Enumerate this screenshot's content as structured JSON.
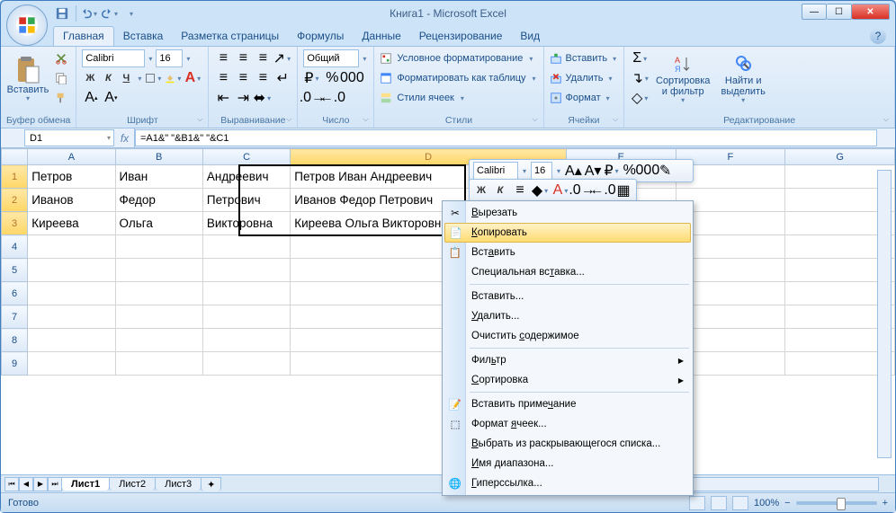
{
  "window": {
    "title": "Книга1 - Microsoft Excel"
  },
  "qat": {
    "save": "save-icon",
    "undo": "undo-icon",
    "redo": "redo-icon"
  },
  "tabs": {
    "items": [
      "Главная",
      "Вставка",
      "Разметка страницы",
      "Формулы",
      "Данные",
      "Рецензирование",
      "Вид"
    ],
    "active": 0
  },
  "ribbon": {
    "clipboard": {
      "paste": "Вставить",
      "label": "Буфер обмена"
    },
    "font": {
      "name": "Calibri",
      "size": "16",
      "label": "Шрифт",
      "bold": "Ж",
      "italic": "К",
      "underline": "Ч"
    },
    "alignment": {
      "label": "Выравнивание"
    },
    "number": {
      "format": "Общий",
      "label": "Число"
    },
    "styles": {
      "cond": "Условное форматирование",
      "table": "Форматировать как таблицу",
      "cell": "Стили ячеек",
      "label": "Стили"
    },
    "cells": {
      "insert": "Вставить",
      "delete": "Удалить",
      "format": "Формат",
      "label": "Ячейки"
    },
    "editing": {
      "sort": "Сортировка и фильтр",
      "find": "Найти и выделить",
      "label": "Редактирование"
    }
  },
  "namebox": "D1",
  "formula": "=A1&\" \"&B1&\" \"&C1",
  "columns": [
    "A",
    "B",
    "C",
    "D",
    "E",
    "F",
    "G"
  ],
  "rows": [
    "1",
    "2",
    "3",
    "4",
    "5",
    "6",
    "7",
    "8",
    "9"
  ],
  "cells": {
    "r1": {
      "a": "Петров",
      "b": "Иван",
      "c": "Андреевич",
      "d": "Петров Иван Андреевич"
    },
    "r2": {
      "a": "Иванов",
      "b": "Федор",
      "c": "Петрович",
      "d": "Иванов Федор Петрович"
    },
    "r3": {
      "a": "Киреева",
      "b": "Ольга",
      "c": "Викторовна",
      "d": "Киреева Ольга Викторовна"
    }
  },
  "sheets": {
    "items": [
      "Лист1",
      "Лист2",
      "Лист3"
    ],
    "active": 0
  },
  "status": {
    "ready": "Готово",
    "zoom": "100%"
  },
  "mini": {
    "font": "Calibri",
    "size": "16",
    "bold": "Ж",
    "italic": "К"
  },
  "ctx": {
    "cut": "Вырезать",
    "copy": "Копировать",
    "paste": "Вставить",
    "paste_special": "Специальная вставка...",
    "insert": "Вставить...",
    "delete": "Удалить...",
    "clear": "Очистить содержимое",
    "filter": "Фильтр",
    "sort": "Сортировка",
    "comment": "Вставить примечание",
    "format_cells": "Формат ячеек...",
    "dropdown": "Выбрать из раскрывающегося списка...",
    "name_range": "Имя диапазона...",
    "hyperlink": "Гиперссылка..."
  }
}
